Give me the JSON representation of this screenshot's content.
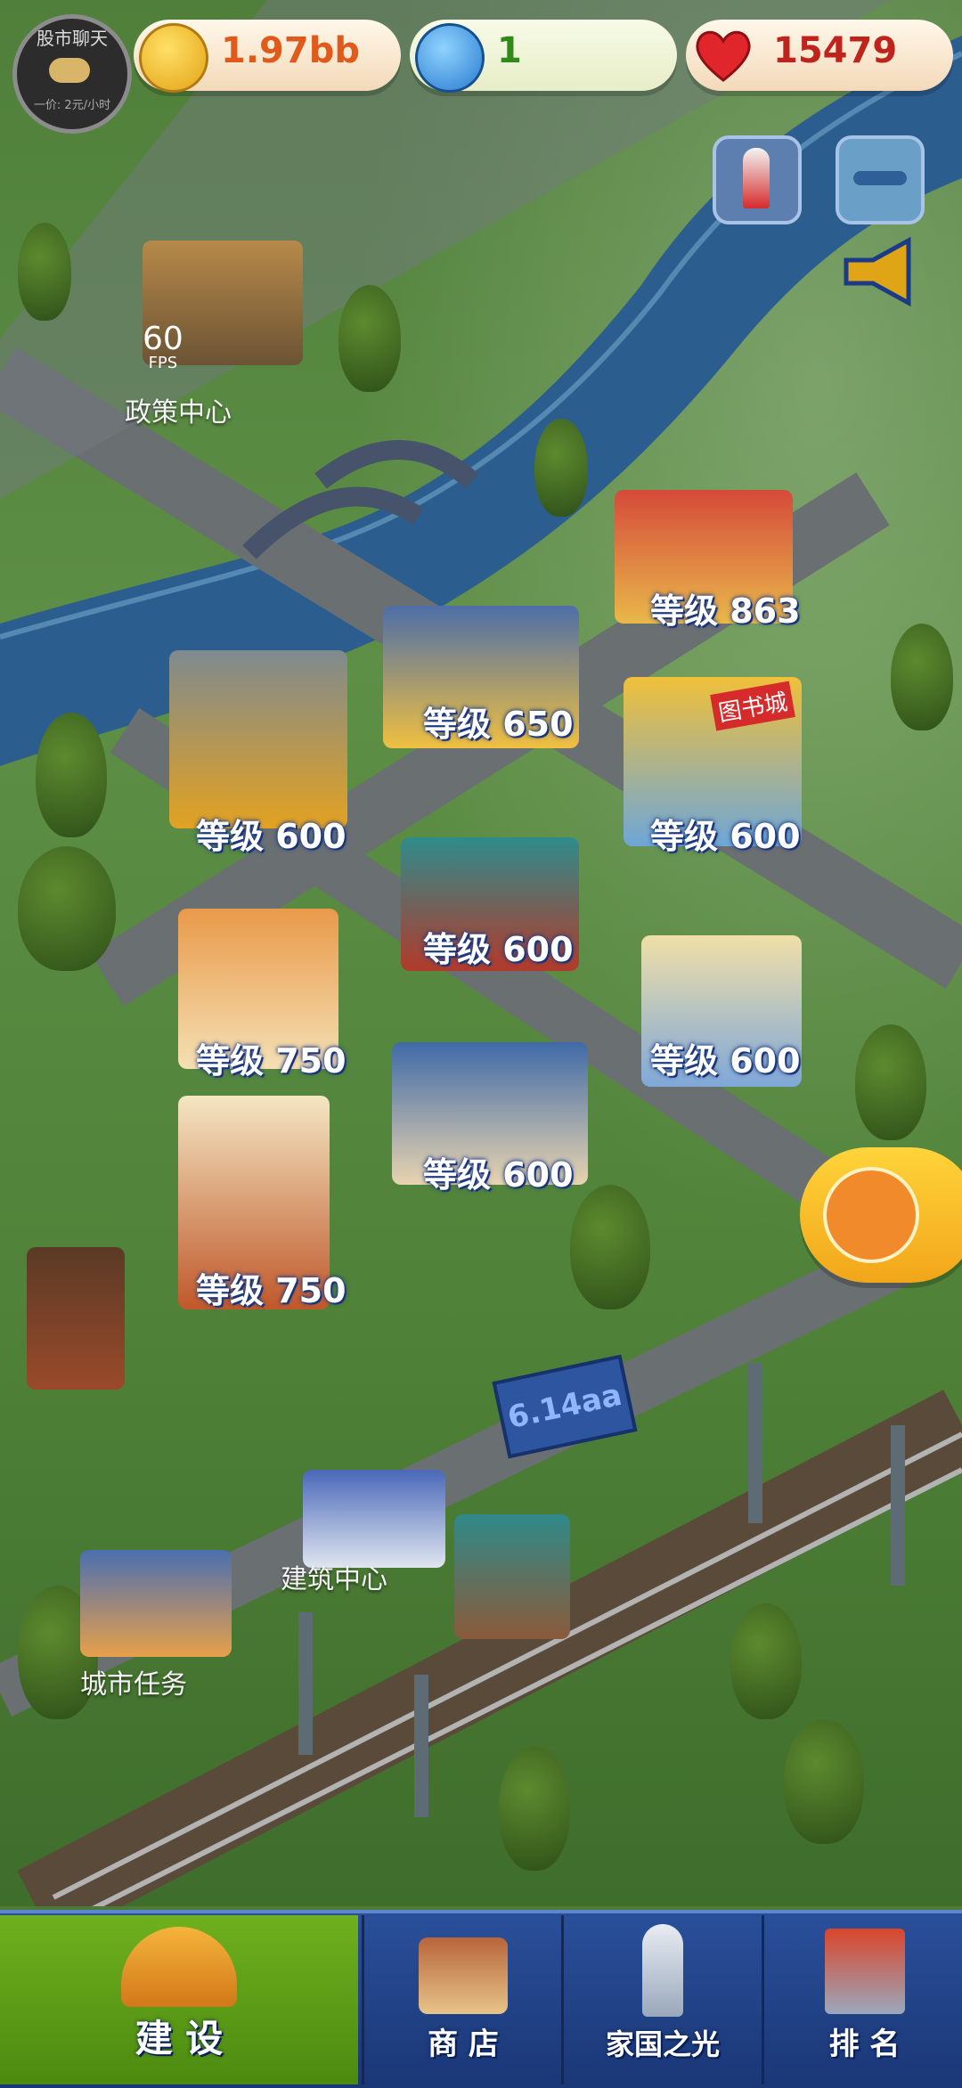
{
  "hud": {
    "coins": "1.97bb",
    "gems": "1",
    "hearts": "15479",
    "avatar_line1": "股市聊天",
    "avatar_line2": "一价: 2元/小时",
    "coin_color": "#e05a1c",
    "gem_color": "#2f8a1a",
    "heart_color": "#c0231c"
  },
  "fps": {
    "value": "60",
    "unit": "FPS"
  },
  "map": {
    "labels": {
      "policy_center": "政策中心",
      "construction_center": "建筑中心",
      "city_tasks": "城市任务",
      "billboard": "6.14aa"
    },
    "buildings": [
      {
        "name": "等级 863"
      },
      {
        "name": "等级 650"
      },
      {
        "name": "等级 600"
      },
      {
        "name": "等级 600"
      },
      {
        "name": "等级 600"
      },
      {
        "name": "等级 750"
      },
      {
        "name": "等级 600"
      },
      {
        "name": "等级 600"
      },
      {
        "name": "等级 750"
      }
    ],
    "sign_bookstore": "图书城"
  },
  "icons": {
    "top_left": "avatar-icon",
    "coin": "coin-icon",
    "gem": "star-gem-icon",
    "heart": "heart-icon",
    "btn1": "rocket-event-icon",
    "btn2": "airplane-icon",
    "speaker": "megaphone-icon",
    "build_edit": "house-pencil-icon"
  },
  "nav": {
    "items": [
      {
        "label": "建 设",
        "icon": "hardhat-icon"
      },
      {
        "label": "商 店",
        "icon": "shop-icon"
      },
      {
        "label": "家国之光",
        "icon": "rocket-icon"
      },
      {
        "label": "排 名",
        "icon": "ranking-icon"
      }
    ],
    "active_color": "#5a9b16",
    "bg_color": "#1e3f86"
  }
}
